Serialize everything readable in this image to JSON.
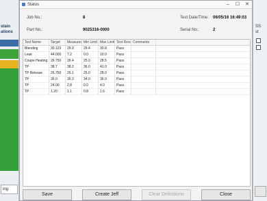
{
  "window": {
    "title": "Status",
    "min": "–",
    "max": "☐",
    "close": "✕"
  },
  "bg_left": {
    "label1": "stain",
    "label2": "ations",
    "tab": "ing"
  },
  "bg_right": {
    "label1": "SS",
    "label2": "st"
  },
  "info": {
    "job_no_label": "Job No.:",
    "job_no_value": "8",
    "test_date_label": "Test Date/Time:",
    "test_date_value": "06/05/16 16:49:03",
    "part_no_label": "Part No.:",
    "part_no_value": "9025316-0000",
    "serial_no_label": "Serial No.:",
    "serial_no_value": "2"
  },
  "grid": {
    "columns": [
      "Test Name",
      "Target",
      "Measured",
      "Min Limit",
      "Max Limit",
      "Test Result",
      "Comments"
    ],
    "rows": [
      [
        "Blending",
        "30.123",
        "29.9",
        "29.4",
        "30.8",
        "Pass",
        ""
      ],
      [
        "Leak",
        "44.000",
        "7.2",
        "0.0",
        "10.0",
        "Pass",
        ""
      ],
      [
        "Coupe Heating",
        "26.750",
        "26.4",
        "25.0",
        "28.5",
        "Pass",
        ""
      ],
      [
        "TP",
        "38.7",
        "38.2",
        "36.0",
        "41.0",
        "Pass",
        ""
      ],
      [
        "TP Release",
        "26.750",
        "26.1",
        "25.0",
        "28.0",
        "Pass",
        ""
      ],
      [
        "TP",
        "35.0",
        "35.3",
        "34.0",
        "36.0",
        "Pass",
        ""
      ],
      [
        "TP",
        "24.00",
        "2.8",
        "0.0",
        "4.0",
        "Pass",
        ""
      ],
      [
        "TP",
        "1.20",
        "1.1",
        "0.8",
        "1.6",
        "Pass",
        ""
      ]
    ]
  },
  "buttons": {
    "save": "Save",
    "create": "Create Jeff",
    "clear_all": "Clear Definitions",
    "close": "Close"
  }
}
